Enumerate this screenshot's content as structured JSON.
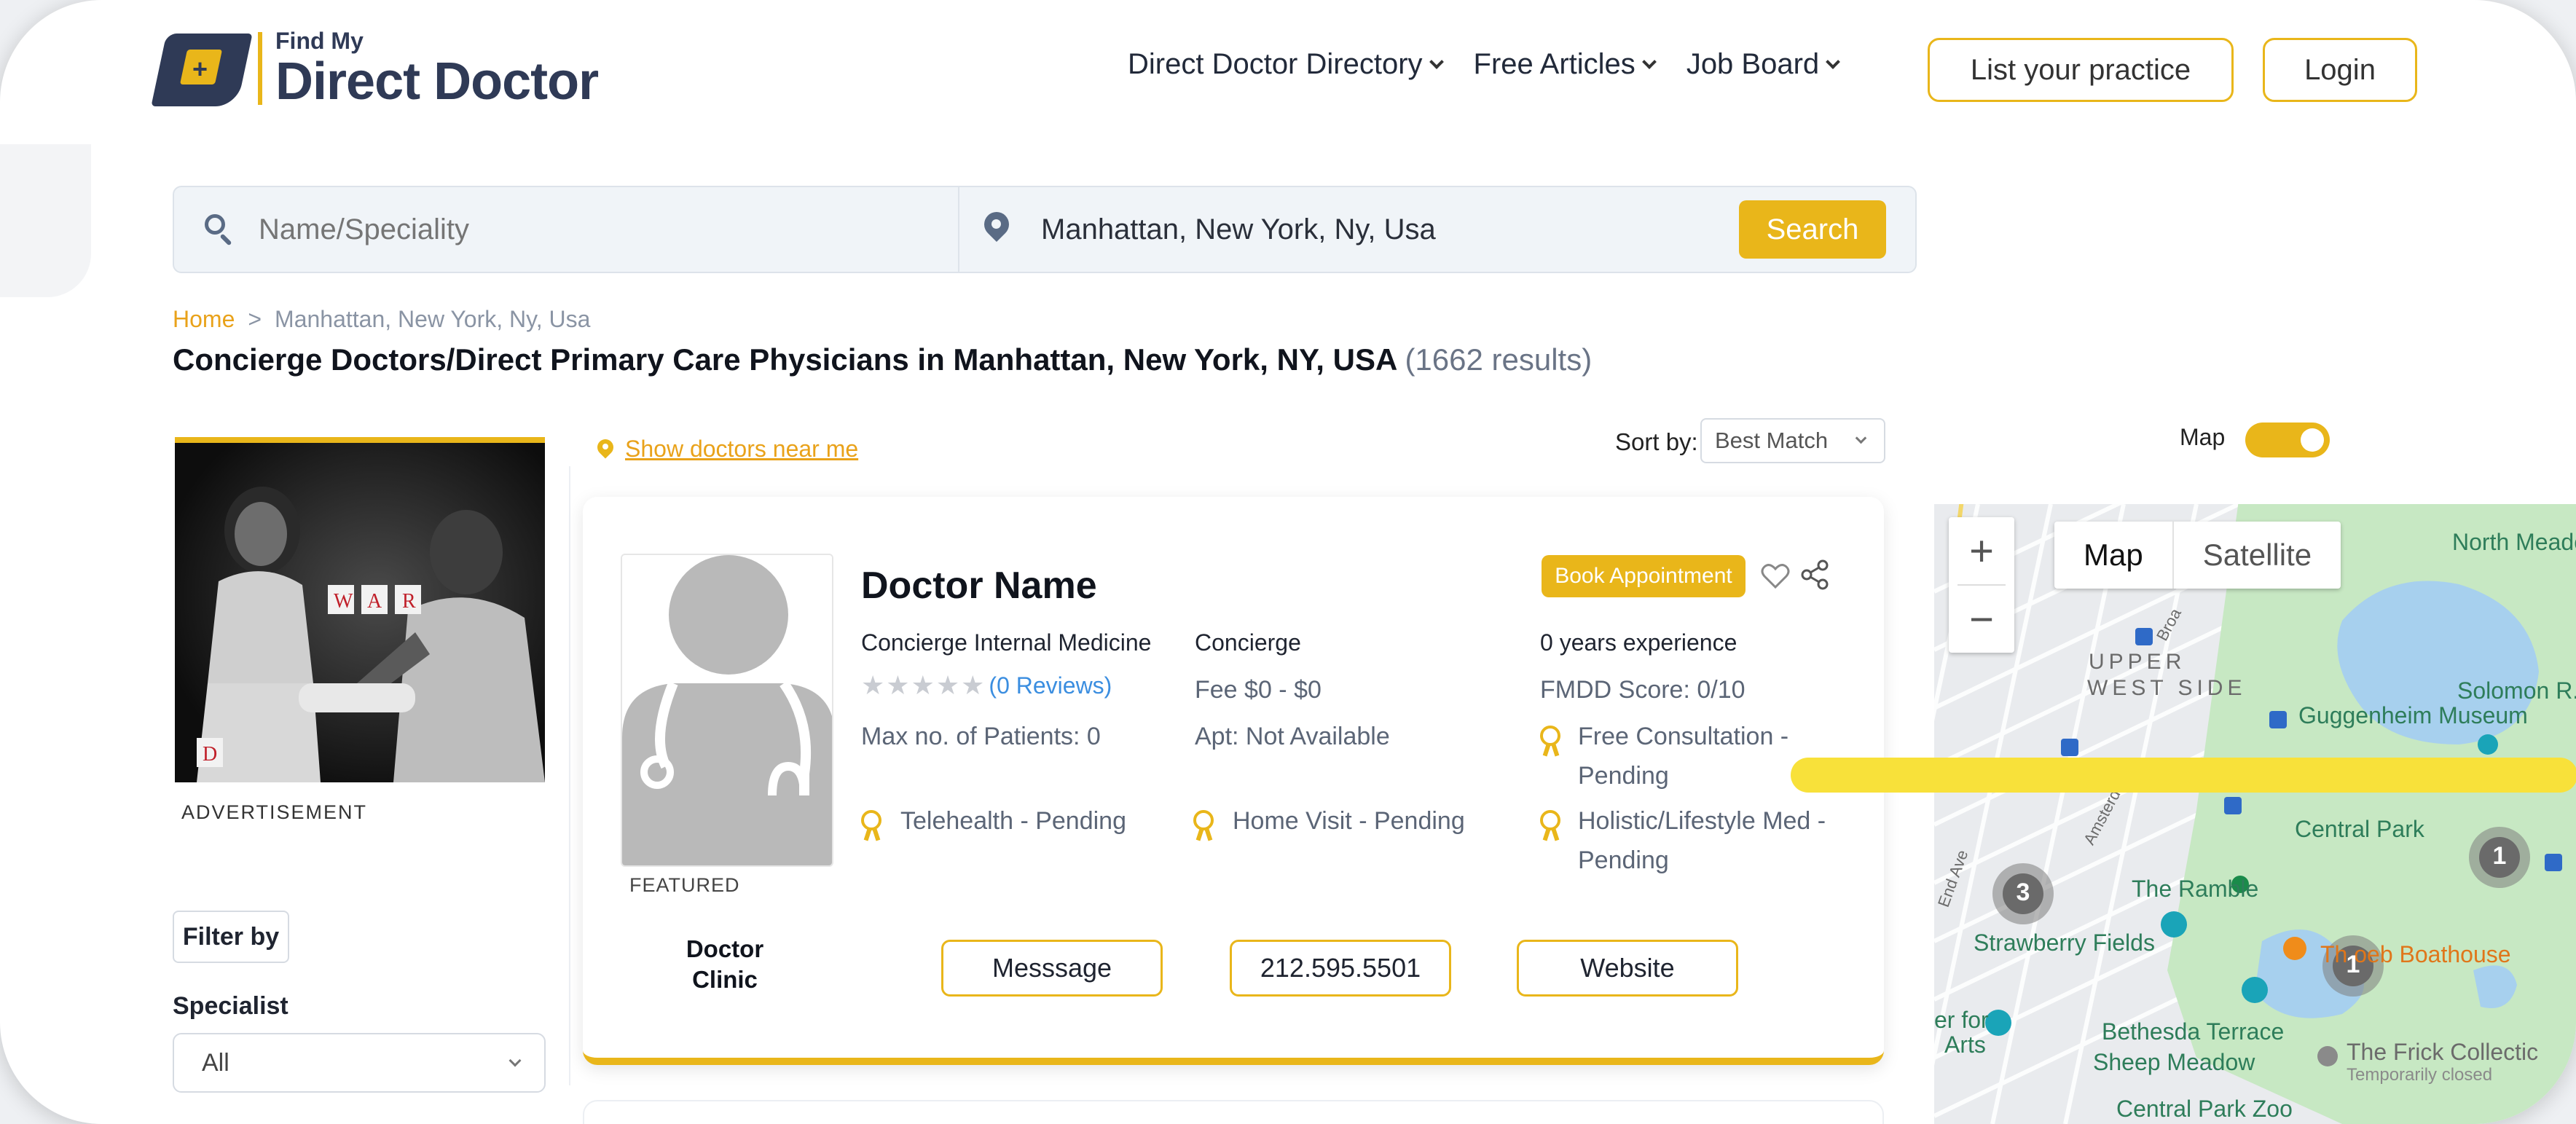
{
  "brand": {
    "small": "Find My",
    "big": "Direct Doctor"
  },
  "nav": {
    "items": [
      {
        "label": "Direct Doctor Directory"
      },
      {
        "label": "Free Articles"
      },
      {
        "label": "Job Board"
      }
    ],
    "list_practice": "List your practice",
    "login": "Login"
  },
  "search": {
    "name_placeholder": "Name/Speciality",
    "location_value": "Manhattan, New York, Ny, Usa",
    "button": "Search"
  },
  "breadcrumb": {
    "home": "Home",
    "sep": ">",
    "current": "Manhattan, New York, Ny, Usa"
  },
  "title": {
    "main": "Concierge Doctors/Direct Primary Care Physicians in Manhattan, New York, NY, USA",
    "count": "(1662 results)"
  },
  "sidebar": {
    "ad_label": "ADVERTISEMENT",
    "filter_by": "Filter by",
    "specialist_label": "Specialist",
    "specialist_value": "All"
  },
  "results": {
    "near_me": "Show doctors near me",
    "sort_label": "Sort by:",
    "sort_value": "Best Match"
  },
  "card": {
    "name": "Doctor Name",
    "book": "Book Appointment",
    "specialty": "Concierge Internal Medicine",
    "type": "Concierge",
    "experience": "0 years experience",
    "reviews": "(0 Reviews)",
    "rating": 0,
    "fee": "Fee $0 - $0",
    "score": "FMDD Score: 0/10",
    "max_patients": "Max no. of Patients: 0",
    "apt": "Apt: Not Available",
    "free_consult_1": "Free Consultation -",
    "free_consult_2": "Pending",
    "telehealth": "Telehealth - Pending",
    "home_visit": "Home Visit - Pending",
    "holistic_1": "Holistic/Lifestyle Med -",
    "holistic_2": "Pending",
    "featured": "FEATURED",
    "clinic_1": "Doctor",
    "clinic_2": "Clinic",
    "message_btn": "Messsage",
    "phone_btn": "212.595.5501",
    "website_btn": "Website"
  },
  "map": {
    "toggle_label": "Map",
    "toggle_on": true,
    "zoom_in": "+",
    "zoom_out": "−",
    "type_map": "Map",
    "type_satellite": "Satellite",
    "labels": {
      "north_meadow": "North Meadov",
      "upper": "UPPER",
      "west_side": "WEST SIDE",
      "solomon": "Solomon R.",
      "guggenheim": "Guggenheim Museum",
      "central_park": "Central Park",
      "ramble": "The Ramble",
      "strawberry": "Strawberry Fields",
      "boathouse": "Th   oeb Boathouse",
      "bethesda": "Bethesda Terrace",
      "sheep": "Sheep Meadow",
      "frick": "The Frick Collectic",
      "temp_closed": "Temporarily closed",
      "cp_zoo": "Central Park Zoo",
      "center_for": "er for",
      "arts": "Arts",
      "end_ave": "End Ave",
      "amsterdam": "Amsterdam",
      "broad": "Broa"
    },
    "clusters": [
      "3",
      "1",
      "1"
    ]
  },
  "colors": {
    "accent": "#e9b61a",
    "brand_navy": "#2f3a56",
    "link": "#3b8ee0",
    "highlight": "#f8e13a"
  }
}
